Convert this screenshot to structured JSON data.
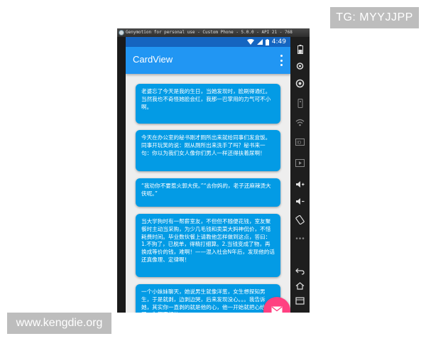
{
  "watermarks": {
    "tg": "TG: MYYJJPP",
    "site": "www.kengdie.org"
  },
  "emulator": {
    "title": "Genymotion for personal use - Custom Phone - 5.0.0 - API 21 - 768"
  },
  "status_bar": {
    "time": "4:49",
    "color": "#1565c0"
  },
  "app_bar": {
    "title": "CardView",
    "color": "#2196f3"
  },
  "cards": [
    {
      "text": "老婆忘了今天是我的生日，当她发现时，脸刷得通红。\n当然我也不奇怪她脸会红，我那一巴掌用的力气可不小啊。"
    },
    {
      "text": "今天在办公室的秘书刚才厕所出来就给同事们发盒饭。同事开玩笑的说：刚从厕所出来洗手了吗？秘书来一句：你以为我们女人像你们男人一样还得扶着尿啊！"
    },
    {
      "text": "“我劝你不要惹火郭大侠。”“去你妈的，老子还麻辣烫大侠呢。”"
    },
    {
      "text": "当大学狗时有一帮薪室友，不但但不随便花钱，室友聚餐时主动当采购，为少几毛钱和卖菜大妈神侃价，不惜耗费时间。毕业数伙餐上请教他怎样做到这点，答曰：1.不狗了，已脱单，得精打细算。2.当钱变成了物，再换成等价的钱，难啊！——混入社会N年后，发现他的话还真像理、定律啊！"
    },
    {
      "text": "一个小妹妹聊天，她说男生就像洋葱，女生想探知男生，于是就剥，边剥边哭，后来发现没心。。。我告诉她，其实你一直剥的就是他的心，他一开始就把心给你了，你都不相信……"
    }
  ],
  "fab": {
    "icon": "mail-icon",
    "color": "#ff4081"
  },
  "sidebar": {
    "icons": [
      "battery-icon",
      "gps-icon",
      "camera-icon",
      "remote-control-icon",
      "wifi-icon",
      "id-icon",
      "media-icon",
      "volume-up-icon",
      "volume-down-icon",
      "rotate-icon",
      "more-icon",
      "back-icon",
      "home-icon",
      "recent-apps-icon"
    ]
  }
}
